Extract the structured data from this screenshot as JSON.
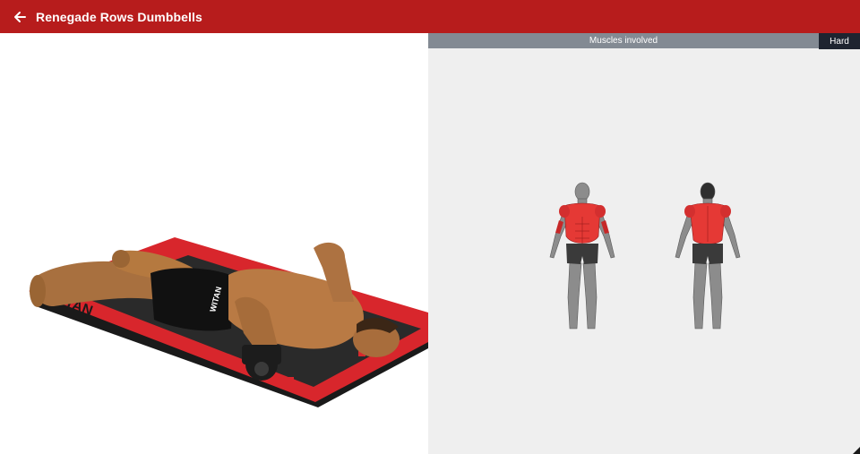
{
  "header": {
    "title": "Renegade Rows Dumbbells",
    "back_icon": "arrow-left-icon",
    "background": "#b71c1c"
  },
  "exercise_image": {
    "mat_brand_text": "TITAN",
    "shorts_text": "WITAN"
  },
  "muscles_panel": {
    "label": "Muscles involved",
    "difficulty": "Hard",
    "highlight_color": "#e53935",
    "views": [
      "front",
      "back"
    ]
  }
}
